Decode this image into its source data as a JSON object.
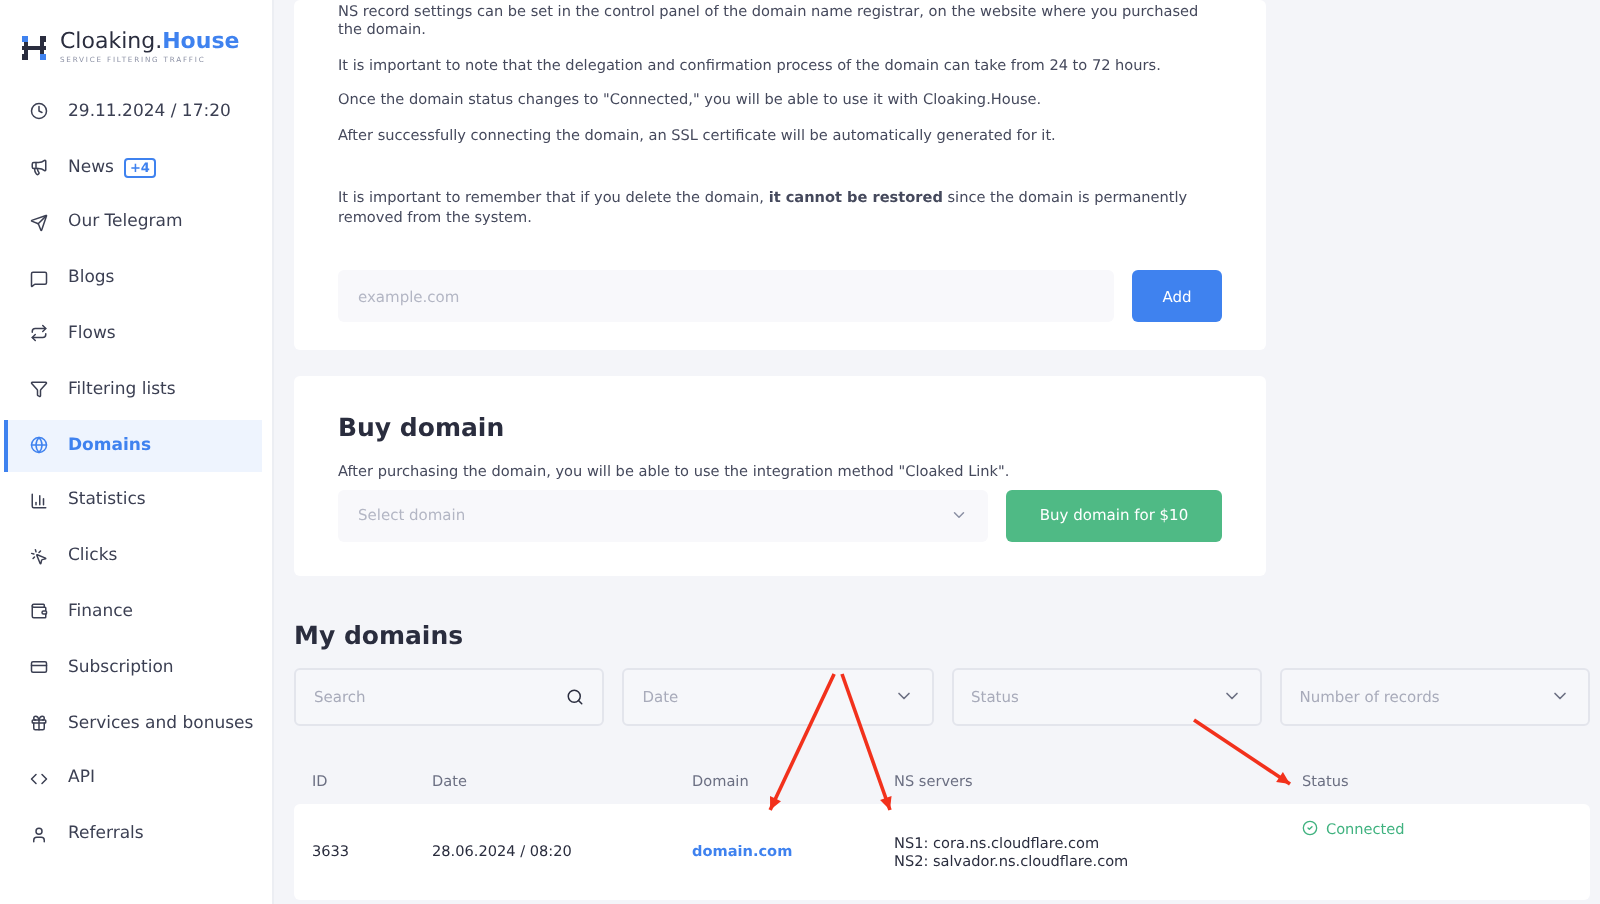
{
  "brand": {
    "name": "Cloaking.",
    "accent": "House",
    "tagline": "SERVICE FILTERING TRAFFIC"
  },
  "sidebar": {
    "items": [
      {
        "kind": "clock",
        "label": "29.11.2024 / 17:20",
        "selected": false
      },
      {
        "kind": "news",
        "label": "News",
        "badge": "+4",
        "selected": false
      },
      {
        "kind": "telegram",
        "label": "Our Telegram",
        "selected": false
      },
      {
        "kind": "blogs",
        "label": "Blogs",
        "selected": false
      },
      {
        "kind": "flows",
        "label": "Flows",
        "selected": false
      },
      {
        "kind": "filter",
        "label": "Filtering lists",
        "selected": false
      },
      {
        "kind": "domains",
        "label": "Domains",
        "selected": true
      },
      {
        "kind": "stats",
        "label": "Statistics",
        "selected": false
      },
      {
        "kind": "clicks",
        "label": "Clicks",
        "selected": false
      },
      {
        "kind": "finance",
        "label": "Finance",
        "selected": false
      },
      {
        "kind": "subscription",
        "label": "Subscription",
        "selected": false
      },
      {
        "kind": "gift",
        "label": "Services and bonuses",
        "selected": false
      },
      {
        "kind": "api",
        "label": "API",
        "selected": false
      },
      {
        "kind": "referrals",
        "label": "Referrals",
        "selected": false
      }
    ]
  },
  "add_domain": {
    "paragraphs": [
      "NS record settings can be set in the control panel of the domain name registrar, on the website where you purchased the domain.",
      "It is important to note that the delegation and confirmation process of the domain can take from 24 to 72 hours.",
      "Once the domain status changes to \"Connected,\" you will be able to use it with Cloaking.House.",
      "After successfully connecting the domain, an SSL certificate will be automatically generated for it.",
      "It is important to remember that if you delete the domain, **it cannot be restored** since the domain is permanently removed from the system."
    ],
    "input": {
      "placeholder": "example.com"
    },
    "button": "Add"
  },
  "buy_domain": {
    "title": "Buy domain",
    "description": "After purchasing the domain, you will be able to use the integration method \"Cloaked Link\".",
    "select": {
      "placeholder": "Select domain"
    },
    "button": "Buy domain for $10"
  },
  "my_domains": {
    "title": "My domains",
    "filters": [
      {
        "kind": "search",
        "placeholder": "Search"
      },
      {
        "kind": "select",
        "placeholder": "Date"
      },
      {
        "kind": "select",
        "placeholder": "Status"
      },
      {
        "kind": "select",
        "placeholder": "Number of records"
      }
    ],
    "table": {
      "columns": [
        "ID",
        "Date",
        "Domain",
        "NS servers",
        "Status"
      ],
      "rows": [
        {
          "id": "3633",
          "date": "28.06.2024 / 08:20",
          "domain": "domain.com",
          "ns": [
            "NS1: cora.ns.cloudflare.com",
            "NS2: salvador.ns.cloudflare.com"
          ],
          "status": "Connected",
          "connected": true
        }
      ]
    }
  }
}
